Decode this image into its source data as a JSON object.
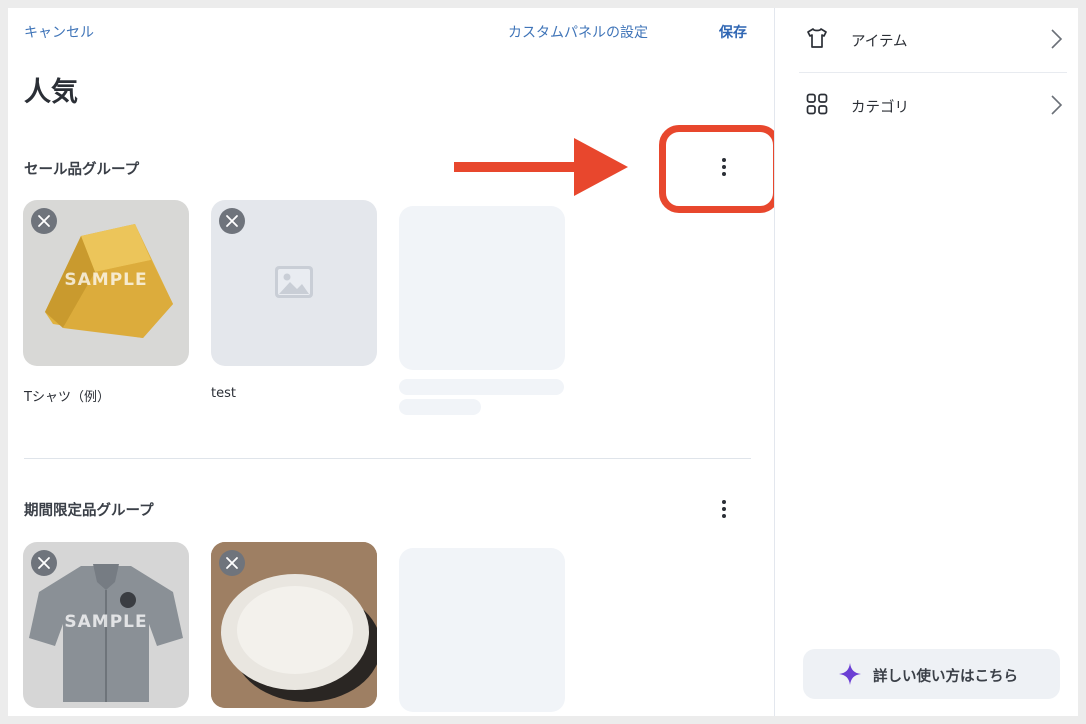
{
  "header": {
    "cancel_label": "キャンセル",
    "custom_panel_label": "カスタムパネルの設定",
    "save_label": "保存"
  },
  "page_title": "人気",
  "groups": [
    {
      "title": "セール品グループ",
      "items": [
        {
          "label": "Tシャツ（例）",
          "watermark": "SAMPLE"
        },
        {
          "label": "test"
        }
      ]
    },
    {
      "title": "期間限定品グループ",
      "items": [
        {
          "label": "",
          "watermark": "SAMPLE"
        },
        {
          "label": ""
        }
      ]
    }
  ],
  "sidebar": {
    "items": [
      {
        "label": "アイテム",
        "icon": "tshirt-icon"
      },
      {
        "label": "カテゴリ",
        "icon": "grid-icon"
      }
    ],
    "help_label": "詳しい使い方はこちら"
  },
  "colors": {
    "link": "#3f74b8",
    "save": "#2f66b3",
    "annotation": "#e8472d",
    "sparkle": "#6b3fd4"
  }
}
